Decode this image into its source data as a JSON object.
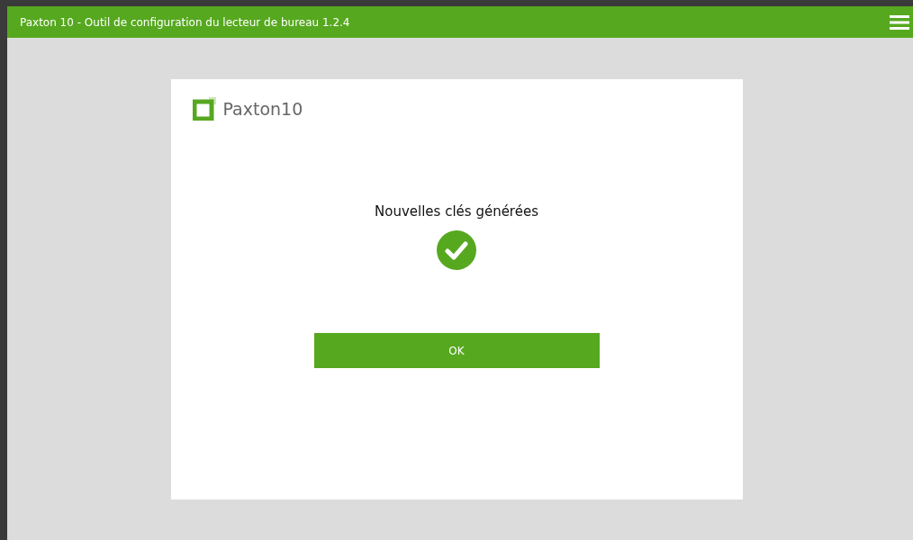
{
  "window": {
    "title": "Paxton 10 - Outil de configuration du lecteur de bureau 1.2.4"
  },
  "logo": {
    "text": "Paxton10"
  },
  "message": "Nouvelles clés générées",
  "buttons": [
    "OK"
  ]
}
